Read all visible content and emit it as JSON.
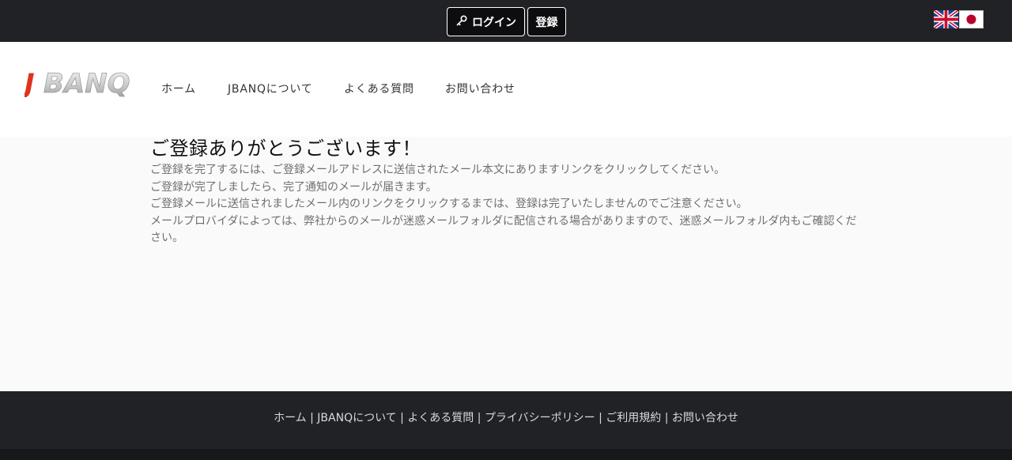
{
  "topbar": {
    "login_label": "ログイン",
    "register_label": "登録",
    "language_flags": [
      "uk-flag-icon",
      "japan-flag-icon"
    ]
  },
  "header": {
    "logo_text": "JBANQ",
    "nav": {
      "home": "ホーム",
      "about": "JBANQについて",
      "faq": "よくある質問",
      "contact": "お問い合わせ"
    }
  },
  "main": {
    "title": "ご登録ありがとうございます！",
    "lines": [
      "ご登録を完了するには、ご登録メールアドレスに送信されたメール本文にありますリンクをクリックしてください。",
      "ご登録が完了しましたら、完了通知のメールが届きます。",
      "ご登録メールに送信されましたメール内のリンクをクリックするまでは、登録は完了いたしませんのでご注意ください。",
      "メールプロバイダによっては、弊社からのメールが迷惑メールフォルダに配信される場合がありますので、迷惑メールフォルダ内もご確認ください。"
    ]
  },
  "footer": {
    "links": {
      "home": "ホーム",
      "about": "JBANQについて",
      "faq": "よくある質問",
      "privacy": "プライバシーポリシー",
      "terms": "ご利用規約",
      "contact": "お問い合わせ"
    },
    "separator": " | "
  },
  "colors": {
    "dark_bar": "#212226",
    "page_bg": "#fafafa",
    "logo_red": "#e0321f"
  }
}
